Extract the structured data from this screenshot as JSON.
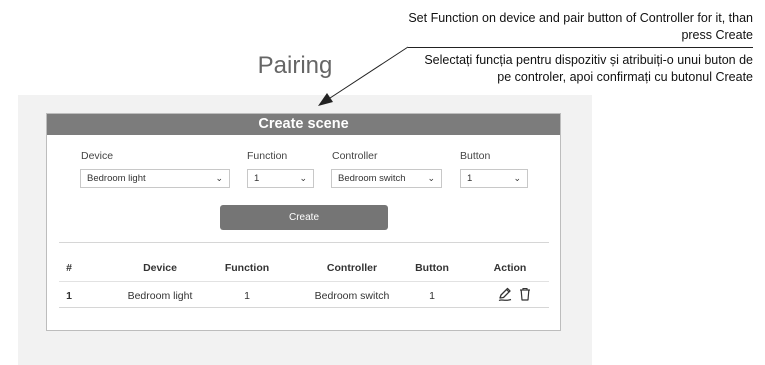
{
  "annotations": {
    "en": "Set Function on device and pair button of Controller for it, than press Create",
    "ro": "Selectați funcția pentru dispozitiv și atribuiți-o unui buton de pe controler, apoi confirmați cu butonul Create"
  },
  "page": {
    "title": "Pairing"
  },
  "card": {
    "title": "Create scene"
  },
  "form": {
    "device": {
      "label": "Device",
      "value": "Bedroom light"
    },
    "function": {
      "label": "Function",
      "value": "1"
    },
    "controller": {
      "label": "Controller",
      "value": "Bedroom switch"
    },
    "button": {
      "label": "Button",
      "value": "1"
    },
    "create_label": "Create"
  },
  "table": {
    "headers": [
      "#",
      "Device",
      "Function",
      "Controller",
      "Button",
      "Action"
    ],
    "rows": [
      {
        "index": "1",
        "device": "Bedroom light",
        "function": "1",
        "controller": "Bedroom switch",
        "button": "1"
      }
    ]
  },
  "icons": {
    "edit": "edit-icon",
    "delete": "trash-icon",
    "dropdown": "chevron-down-icon"
  }
}
